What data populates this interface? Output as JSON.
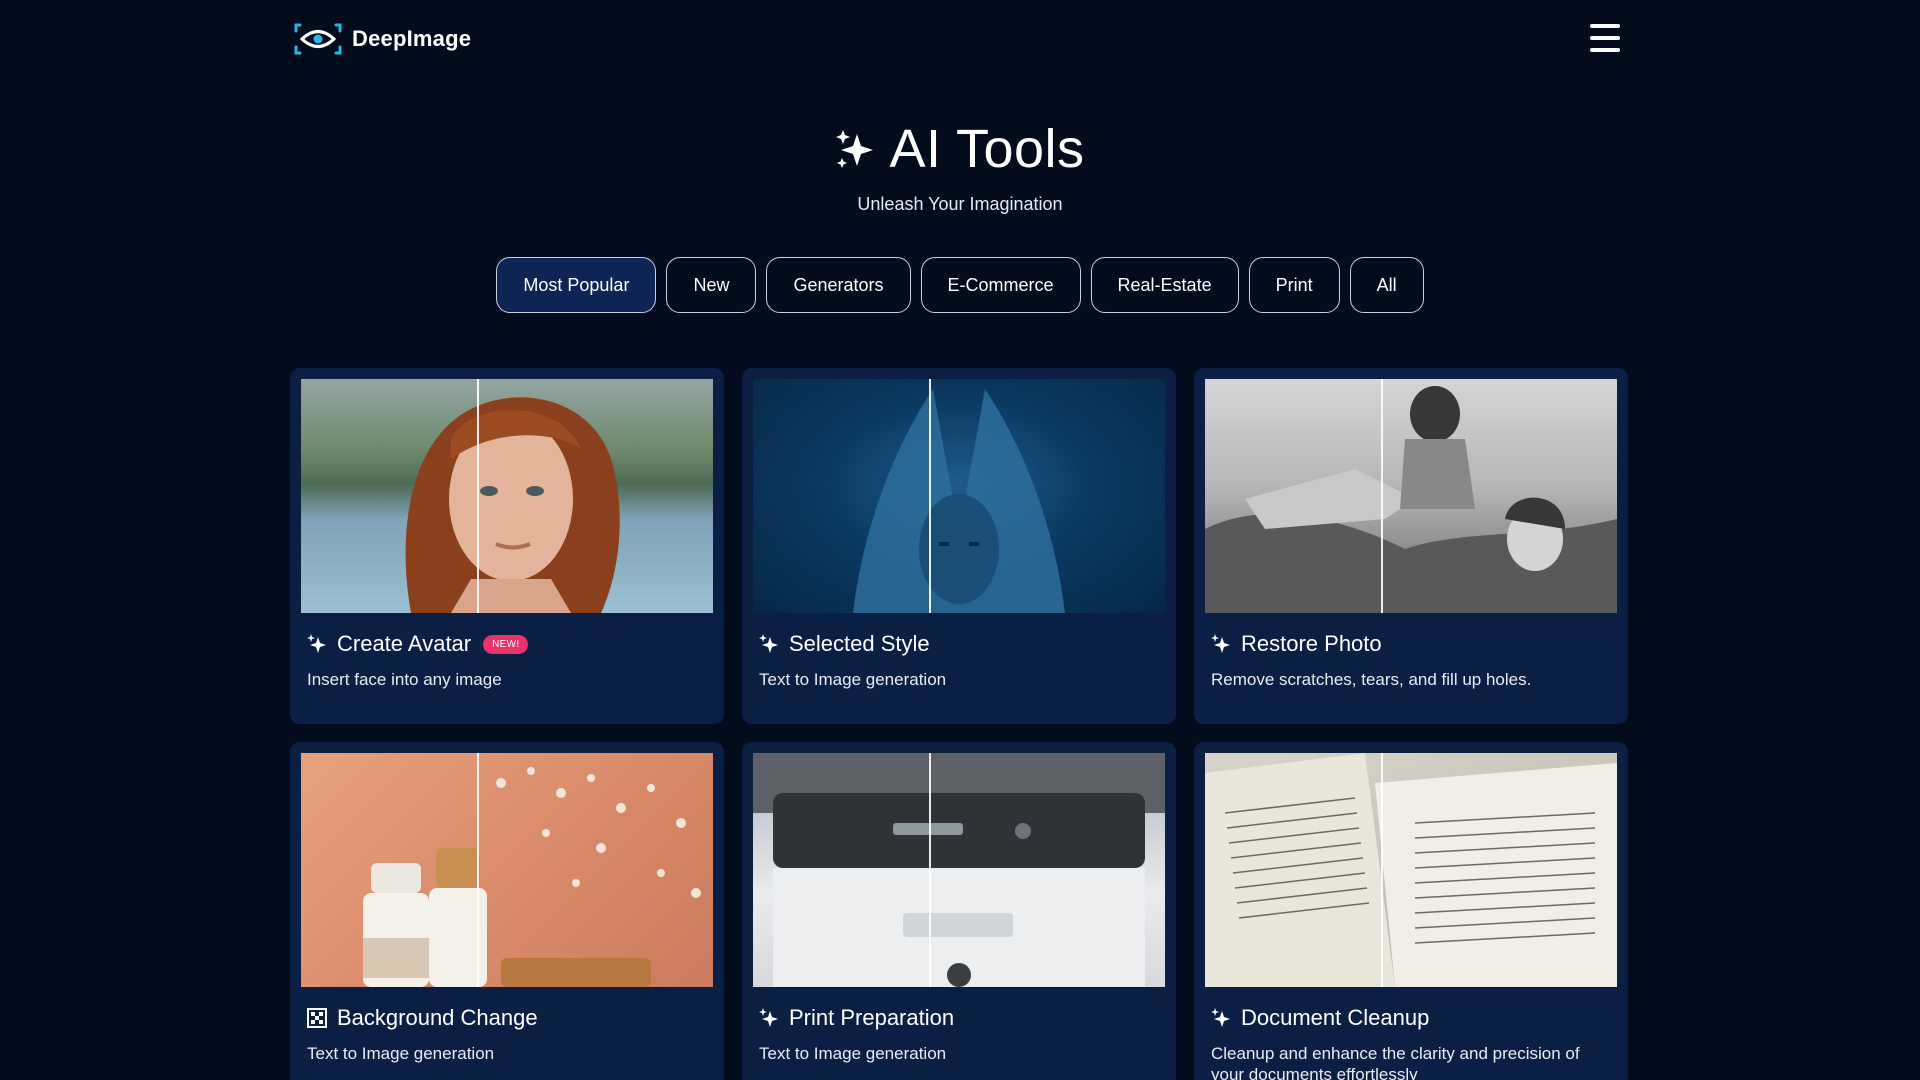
{
  "brand": {
    "name": "DeepImage"
  },
  "header": {
    "menu_icon": "hamburger-menu-icon"
  },
  "hero": {
    "title": "AI Tools",
    "subtitle": "Unleash Your Imagination",
    "icon": "sparkles-icon"
  },
  "filters": [
    {
      "label": "Most Popular",
      "active": true
    },
    {
      "label": "New",
      "active": false
    },
    {
      "label": "Generators",
      "active": false
    },
    {
      "label": "E-Commerce",
      "active": false
    },
    {
      "label": "Real-Estate",
      "active": false
    },
    {
      "label": "Print",
      "active": false
    },
    {
      "label": "All",
      "active": false
    }
  ],
  "cards": [
    {
      "title": "Create Avatar",
      "badge": "NEW!",
      "description": "Insert face into any image",
      "icon": "sparkles-icon"
    },
    {
      "title": "Selected Style",
      "description": "Text to Image generation",
      "icon": "sparkles-icon"
    },
    {
      "title": "Restore Photo",
      "description": "Remove scratches, tears, and fill up holes.",
      "icon": "sparkles-icon"
    },
    {
      "title": "Background Change",
      "description": "Text to Image generation",
      "icon": "checkerboard-icon"
    },
    {
      "title": "Print Preparation",
      "description": "Text to Image generation",
      "icon": "sparkles-icon"
    },
    {
      "title": "Document Cleanup",
      "description": "Cleanup and enhance the clarity and precision of your documents effortlessly",
      "icon": "sparkles-icon"
    }
  ],
  "colors": {
    "background": "#030c1d",
    "card": "#0b1f45",
    "active_chip": "#0d2554",
    "badge": "#e8336b",
    "logo_accent": "#29b6e8"
  }
}
